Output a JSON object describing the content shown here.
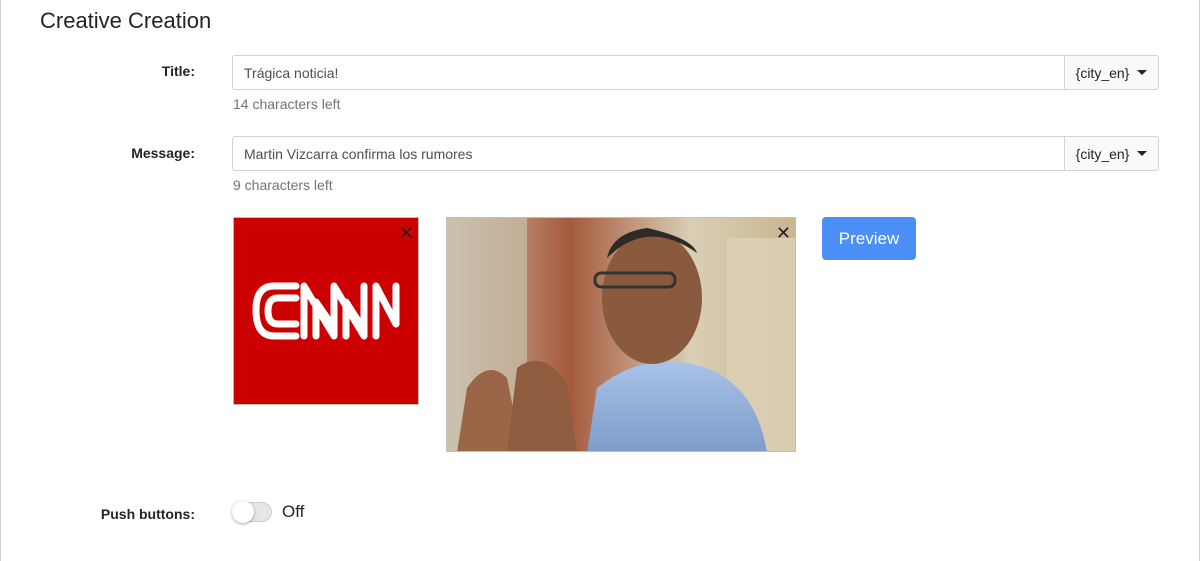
{
  "page": {
    "title": "Creative Creation"
  },
  "form": {
    "title": {
      "label": "Title:",
      "value": "Trágica noticia!",
      "macro": "{city_en}",
      "hint": "14 characters left"
    },
    "message": {
      "label": "Message:",
      "value": "Martin Vizcarra confirma los rumores",
      "macro": "{city_en}",
      "hint": "9 characters left"
    },
    "images": {
      "icon": {
        "logo_text": "CNN",
        "bg_color": "#cc0000",
        "close": "✕"
      },
      "photo": {
        "close": "✕"
      }
    },
    "preview_label": "Preview",
    "push_buttons": {
      "label": "Push buttons:",
      "state": "Off"
    }
  },
  "colors": {
    "accent": "#4b8ff7",
    "cnn_red": "#cc0000"
  },
  "icons": [
    "close-icon",
    "caret-down-icon"
  ]
}
